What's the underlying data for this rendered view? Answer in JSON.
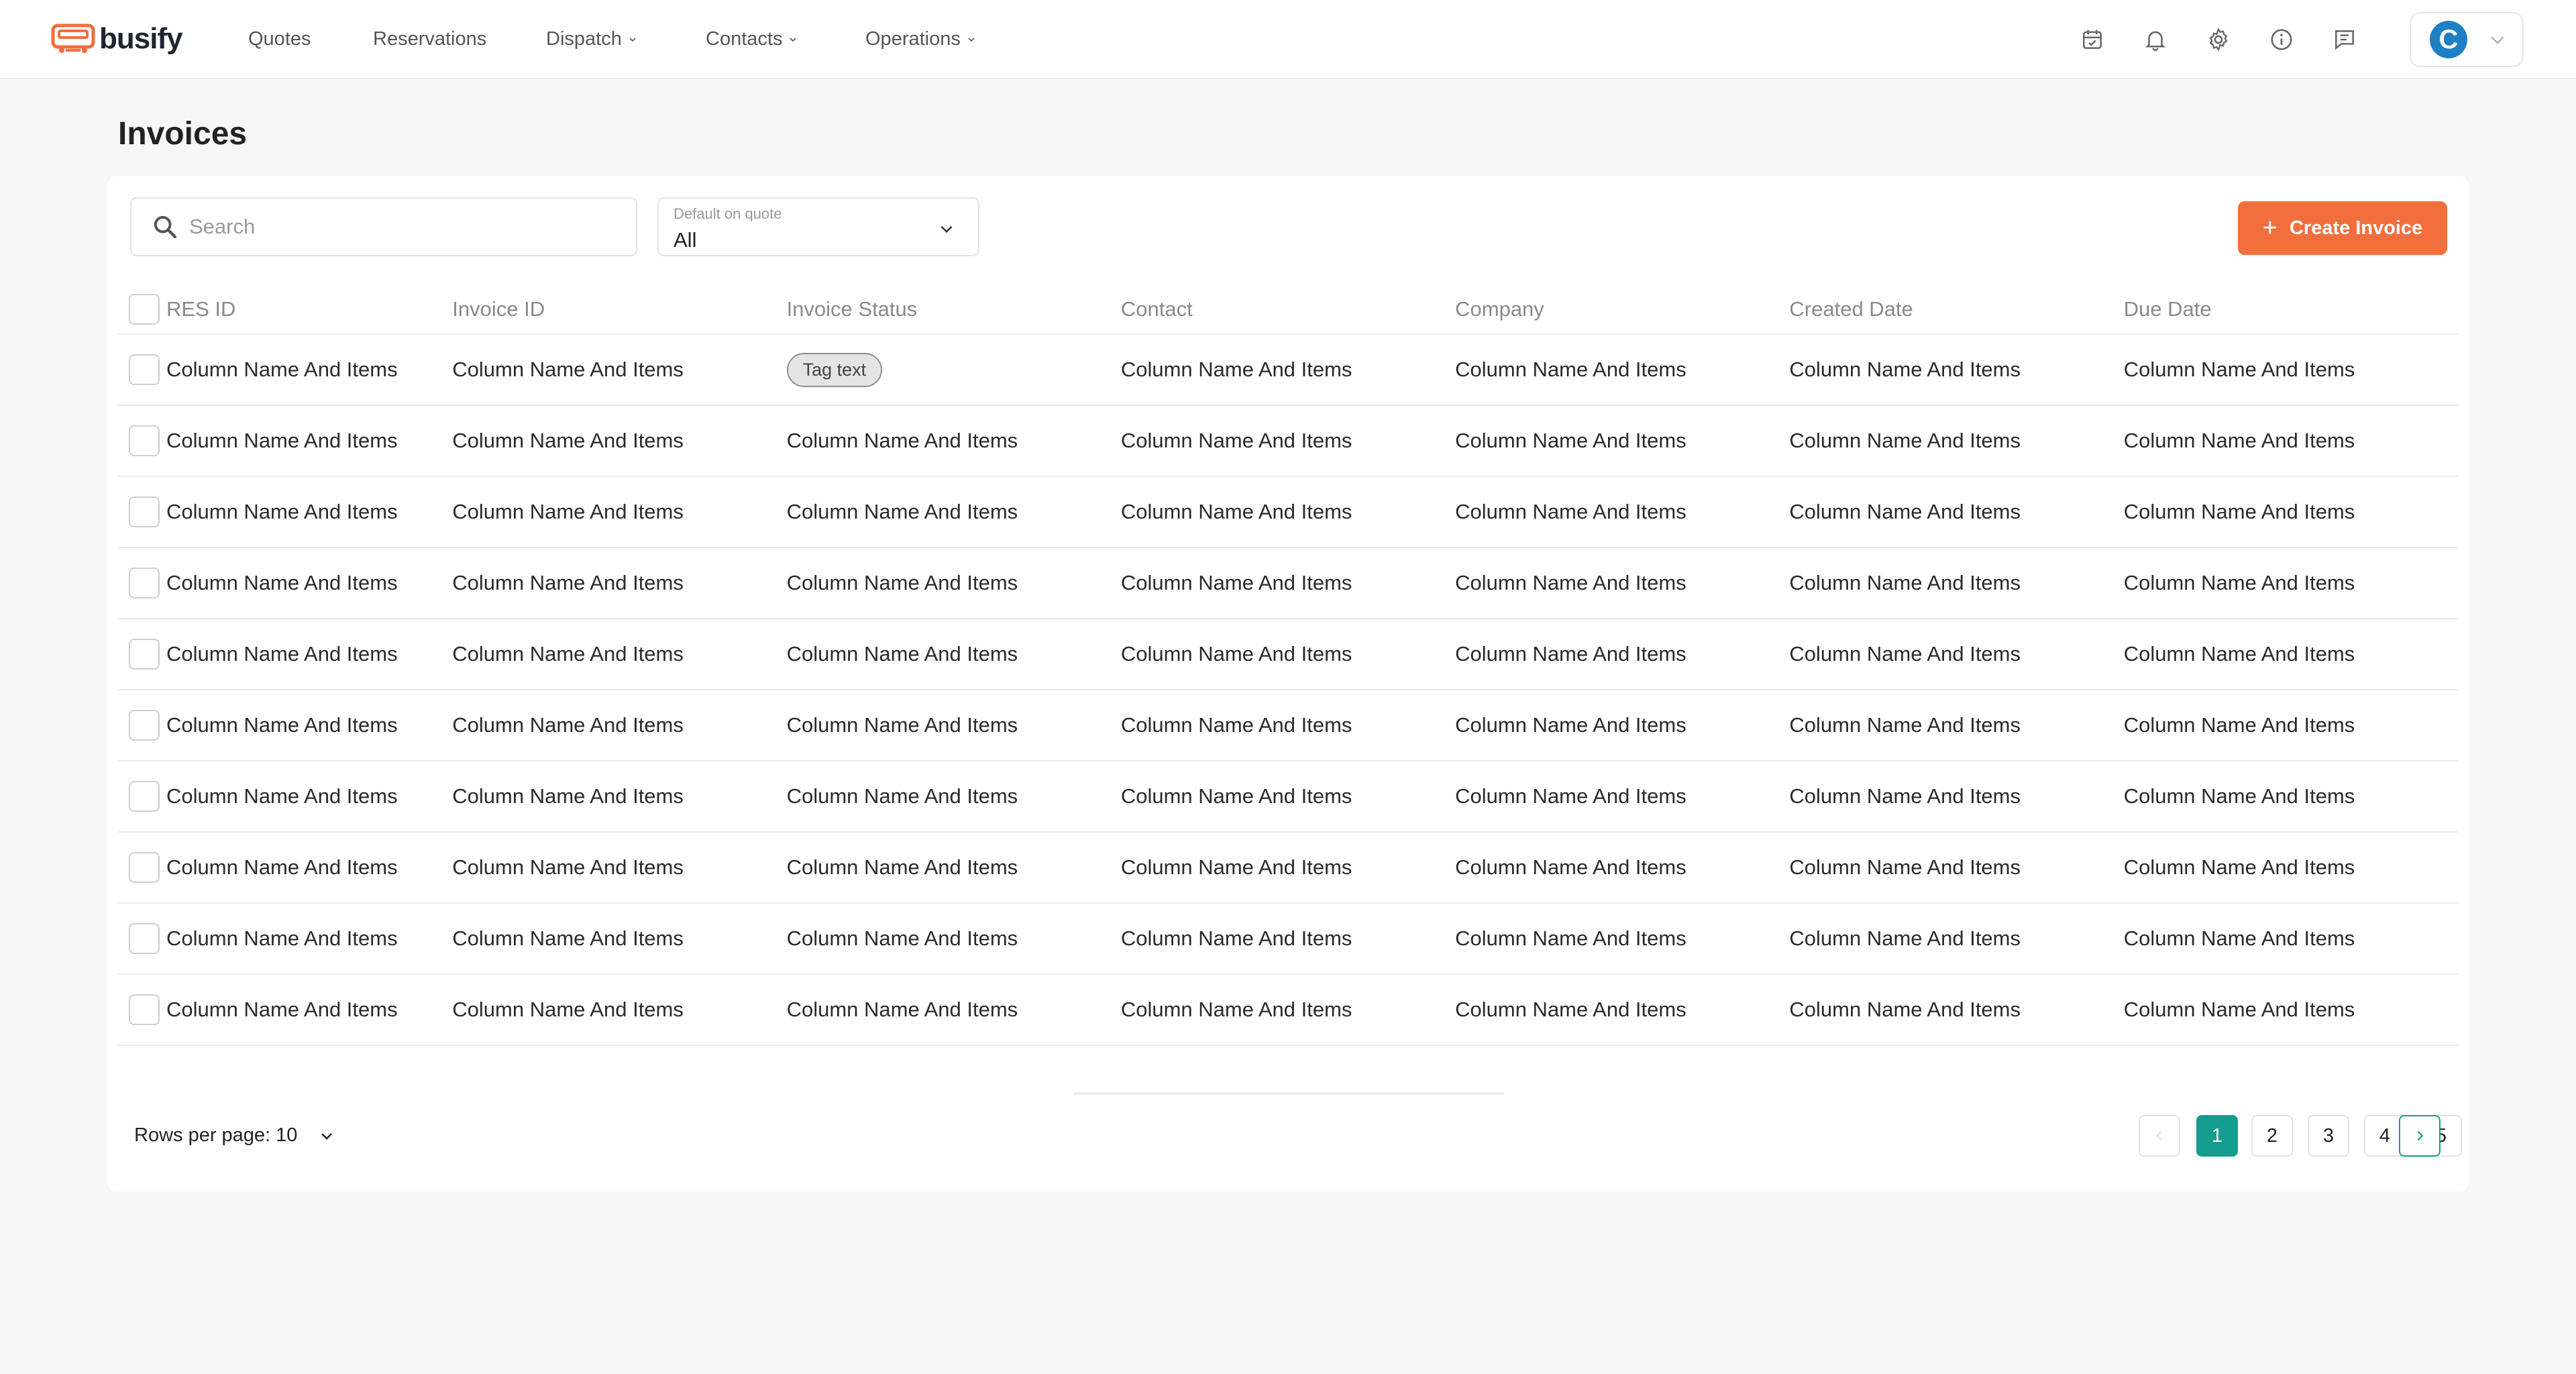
{
  "app": {
    "brand": "busify"
  },
  "nav": {
    "items": [
      {
        "label": "Quotes",
        "has_dropdown": false
      },
      {
        "label": "Reservations",
        "has_dropdown": false
      },
      {
        "label": "Dispatch",
        "has_dropdown": true
      },
      {
        "label": "Contacts",
        "has_dropdown": true
      },
      {
        "label": "Operations",
        "has_dropdown": true
      }
    ],
    "icons": [
      "calendar-check-icon",
      "bell-icon",
      "gear-icon",
      "info-icon",
      "message-icon"
    ],
    "user": {
      "avatar_initial": "C"
    }
  },
  "page": {
    "title": "Invoices"
  },
  "toolbar": {
    "search_placeholder": "Search",
    "filter_label": "Default on quote",
    "filter_value": "All",
    "create_label": "Create Invoice"
  },
  "table": {
    "columns": [
      "RES ID",
      "Invoice ID",
      "Invoice Status",
      "Contact",
      "Company",
      "Created Date",
      "Due Date"
    ],
    "rows": [
      [
        "Column Name And Items",
        "Column Name And Items",
        "Tag text",
        "Column Name And Items",
        "Column Name And Items",
        "Column Name And Items",
        "Column Name And Items"
      ],
      [
        "Column Name And Items",
        "Column Name And Items",
        "Column Name And Items",
        "Column Name And Items",
        "Column Name And Items",
        "Column Name And Items",
        "Column Name And Items"
      ],
      [
        "Column Name And Items",
        "Column Name And Items",
        "Column Name And Items",
        "Column Name And Items",
        "Column Name And Items",
        "Column Name And Items",
        "Column Name And Items"
      ],
      [
        "Column Name And Items",
        "Column Name And Items",
        "Column Name And Items",
        "Column Name And Items",
        "Column Name And Items",
        "Column Name And Items",
        "Column Name And Items"
      ],
      [
        "Column Name And Items",
        "Column Name And Items",
        "Column Name And Items",
        "Column Name And Items",
        "Column Name And Items",
        "Column Name And Items",
        "Column Name And Items"
      ],
      [
        "Column Name And Items",
        "Column Name And Items",
        "Column Name And Items",
        "Column Name And Items",
        "Column Name And Items",
        "Column Name And Items",
        "Column Name And Items"
      ],
      [
        "Column Name And Items",
        "Column Name And Items",
        "Column Name And Items",
        "Column Name And Items",
        "Column Name And Items",
        "Column Name And Items",
        "Column Name And Items"
      ],
      [
        "Column Name And Items",
        "Column Name And Items",
        "Column Name And Items",
        "Column Name And Items",
        "Column Name And Items",
        "Column Name And Items",
        "Column Name And Items"
      ],
      [
        "Column Name And Items",
        "Column Name And Items",
        "Column Name And Items",
        "Column Name And Items",
        "Column Name And Items",
        "Column Name And Items",
        "Column Name And Items"
      ],
      [
        "Column Name And Items",
        "Column Name And Items",
        "Column Name And Items",
        "Column Name And Items",
        "Column Name And Items",
        "Column Name And Items",
        "Column Name And Items"
      ]
    ],
    "tag_cells": [
      [
        0,
        2
      ]
    ]
  },
  "pagination": {
    "rows_per_page_label": "Rows per page: 10",
    "pages": [
      "1",
      "2",
      "3",
      "4",
      "5"
    ],
    "current_page": "1"
  },
  "colors": {
    "brand_orange": "#f26f3d",
    "accent_teal": "#139d8e",
    "avatar_blue": "#1f7fc4"
  }
}
